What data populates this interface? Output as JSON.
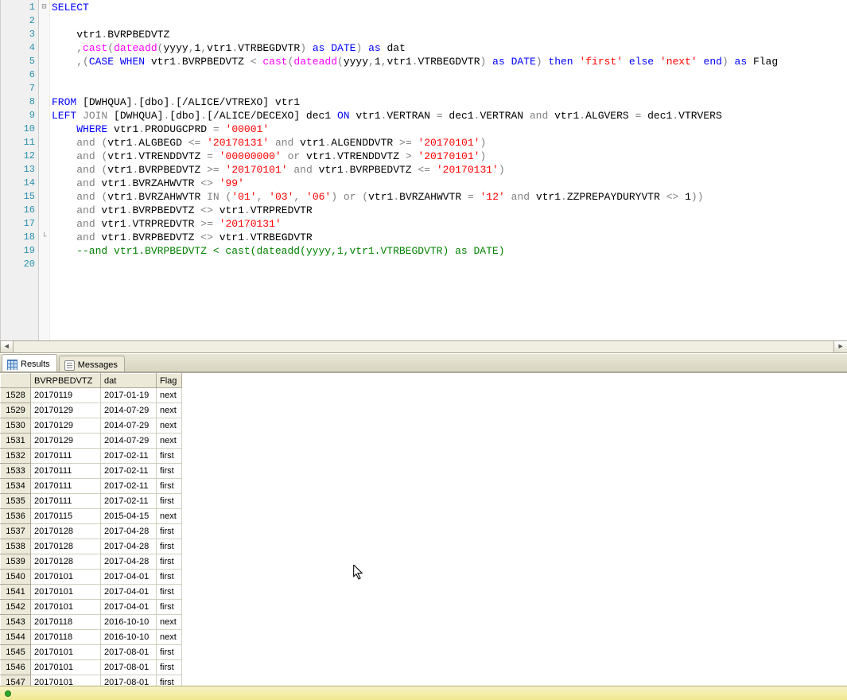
{
  "editor": {
    "lines": [
      {
        "n": 1,
        "fold": "⊟",
        "tokens": [
          {
            "t": "SELECT",
            "c": "kw"
          }
        ]
      },
      {
        "n": 2,
        "fold": "",
        "tokens": []
      },
      {
        "n": 3,
        "fold": "",
        "tokens": [
          {
            "t": "    vtr1"
          },
          {
            "t": ".",
            "c": "op"
          },
          {
            "t": "BVRPBEDVTZ"
          }
        ]
      },
      {
        "n": 4,
        "fold": "",
        "tokens": [
          {
            "t": "    "
          },
          {
            "t": ",",
            "c": "op"
          },
          {
            "t": "cast",
            "c": "fn"
          },
          {
            "t": "(",
            "c": "op"
          },
          {
            "t": "dateadd",
            "c": "fn"
          },
          {
            "t": "(",
            "c": "op"
          },
          {
            "t": "yyyy"
          },
          {
            "t": ",",
            "c": "op"
          },
          {
            "t": "1"
          },
          {
            "t": ",",
            "c": "op"
          },
          {
            "t": "vtr1"
          },
          {
            "t": ".",
            "c": "op"
          },
          {
            "t": "VTRBEGDVTR"
          },
          {
            "t": ")",
            "c": "op"
          },
          {
            "t": " "
          },
          {
            "t": "as",
            "c": "kw"
          },
          {
            "t": " "
          },
          {
            "t": "DATE",
            "c": "kw"
          },
          {
            "t": ")",
            "c": "op"
          },
          {
            "t": " "
          },
          {
            "t": "as",
            "c": "kw"
          },
          {
            "t": " dat"
          }
        ]
      },
      {
        "n": 5,
        "fold": "",
        "tokens": [
          {
            "t": "    "
          },
          {
            "t": ",(",
            "c": "op"
          },
          {
            "t": "CASE",
            "c": "kw"
          },
          {
            "t": " "
          },
          {
            "t": "WHEN",
            "c": "kw"
          },
          {
            "t": " vtr1"
          },
          {
            "t": ".",
            "c": "op"
          },
          {
            "t": "BVRPBEDVTZ "
          },
          {
            "t": "<",
            "c": "op"
          },
          {
            "t": " "
          },
          {
            "t": "cast",
            "c": "fn"
          },
          {
            "t": "(",
            "c": "op"
          },
          {
            "t": "dateadd",
            "c": "fn"
          },
          {
            "t": "(",
            "c": "op"
          },
          {
            "t": "yyyy"
          },
          {
            "t": ",",
            "c": "op"
          },
          {
            "t": "1"
          },
          {
            "t": ",",
            "c": "op"
          },
          {
            "t": "vtr1"
          },
          {
            "t": ".",
            "c": "op"
          },
          {
            "t": "VTRBEGDVTR"
          },
          {
            "t": ")",
            "c": "op"
          },
          {
            "t": " "
          },
          {
            "t": "as",
            "c": "kw"
          },
          {
            "t": " "
          },
          {
            "t": "DATE",
            "c": "kw"
          },
          {
            "t": ")",
            "c": "op"
          },
          {
            "t": " "
          },
          {
            "t": "then",
            "c": "kw"
          },
          {
            "t": " "
          },
          {
            "t": "'first'",
            "c": "str"
          },
          {
            "t": " "
          },
          {
            "t": "else",
            "c": "kw"
          },
          {
            "t": " "
          },
          {
            "t": "'next'",
            "c": "str"
          },
          {
            "t": " "
          },
          {
            "t": "end",
            "c": "kw"
          },
          {
            "t": ")",
            "c": "op"
          },
          {
            "t": " "
          },
          {
            "t": "as",
            "c": "kw"
          },
          {
            "t": " Flag"
          }
        ]
      },
      {
        "n": 6,
        "fold": "",
        "tokens": []
      },
      {
        "n": 7,
        "fold": "",
        "tokens": []
      },
      {
        "n": 8,
        "fold": "",
        "tokens": [
          {
            "t": "FROM",
            "c": "kw"
          },
          {
            "t": " [DWHQUA]"
          },
          {
            "t": ".",
            "c": "op"
          },
          {
            "t": "[dbo]"
          },
          {
            "t": ".",
            "c": "op"
          },
          {
            "t": "[/ALICE/VTREXO] vtr1"
          }
        ]
      },
      {
        "n": 9,
        "fold": "",
        "tokens": [
          {
            "t": "LEFT",
            "c": "kw"
          },
          {
            "t": " "
          },
          {
            "t": "JOIN",
            "c": "op"
          },
          {
            "t": " [DWHQUA]"
          },
          {
            "t": ".",
            "c": "op"
          },
          {
            "t": "[dbo]"
          },
          {
            "t": ".",
            "c": "op"
          },
          {
            "t": "[/ALICE/DECEXO] dec1 "
          },
          {
            "t": "ON",
            "c": "kw"
          },
          {
            "t": " vtr1"
          },
          {
            "t": ".",
            "c": "op"
          },
          {
            "t": "VERTRAN "
          },
          {
            "t": "=",
            "c": "op"
          },
          {
            "t": " dec1"
          },
          {
            "t": ".",
            "c": "op"
          },
          {
            "t": "VERTRAN "
          },
          {
            "t": "and",
            "c": "op"
          },
          {
            "t": " vtr1"
          },
          {
            "t": ".",
            "c": "op"
          },
          {
            "t": "ALGVERS "
          },
          {
            "t": "=",
            "c": "op"
          },
          {
            "t": " dec1"
          },
          {
            "t": ".",
            "c": "op"
          },
          {
            "t": "VTRVERS"
          }
        ]
      },
      {
        "n": 10,
        "fold": "",
        "tokens": [
          {
            "t": "    "
          },
          {
            "t": "WHERE",
            "c": "kw"
          },
          {
            "t": " vtr1"
          },
          {
            "t": ".",
            "c": "op"
          },
          {
            "t": "PRODUGCPRD "
          },
          {
            "t": "=",
            "c": "op"
          },
          {
            "t": " "
          },
          {
            "t": "'00001'",
            "c": "str"
          }
        ]
      },
      {
        "n": 11,
        "fold": "",
        "tokens": [
          {
            "t": "    "
          },
          {
            "t": "and",
            "c": "op"
          },
          {
            "t": " "
          },
          {
            "t": "(",
            "c": "op"
          },
          {
            "t": "vtr1"
          },
          {
            "t": ".",
            "c": "op"
          },
          {
            "t": "ALGBEGD "
          },
          {
            "t": "<=",
            "c": "op"
          },
          {
            "t": " "
          },
          {
            "t": "'20170131'",
            "c": "str"
          },
          {
            "t": " "
          },
          {
            "t": "and",
            "c": "op"
          },
          {
            "t": " vtr1"
          },
          {
            "t": ".",
            "c": "op"
          },
          {
            "t": "ALGENDDVTR "
          },
          {
            "t": ">=",
            "c": "op"
          },
          {
            "t": " "
          },
          {
            "t": "'20170101'",
            "c": "str"
          },
          {
            "t": ")",
            "c": "op"
          }
        ]
      },
      {
        "n": 12,
        "fold": "",
        "tokens": [
          {
            "t": "    "
          },
          {
            "t": "and",
            "c": "op"
          },
          {
            "t": " "
          },
          {
            "t": "(",
            "c": "op"
          },
          {
            "t": "vtr1"
          },
          {
            "t": ".",
            "c": "op"
          },
          {
            "t": "VTRENDDVTZ "
          },
          {
            "t": "=",
            "c": "op"
          },
          {
            "t": " "
          },
          {
            "t": "'00000000'",
            "c": "str"
          },
          {
            "t": " "
          },
          {
            "t": "or",
            "c": "op"
          },
          {
            "t": " vtr1"
          },
          {
            "t": ".",
            "c": "op"
          },
          {
            "t": "VTRENDDVTZ "
          },
          {
            "t": ">",
            "c": "op"
          },
          {
            "t": " "
          },
          {
            "t": "'20170101'",
            "c": "str"
          },
          {
            "t": ")",
            "c": "op"
          }
        ]
      },
      {
        "n": 13,
        "fold": "",
        "tokens": [
          {
            "t": "    "
          },
          {
            "t": "and",
            "c": "op"
          },
          {
            "t": " "
          },
          {
            "t": "(",
            "c": "op"
          },
          {
            "t": "vtr1"
          },
          {
            "t": ".",
            "c": "op"
          },
          {
            "t": "BVRPBEDVTZ "
          },
          {
            "t": ">=",
            "c": "op"
          },
          {
            "t": " "
          },
          {
            "t": "'20170101'",
            "c": "str"
          },
          {
            "t": " "
          },
          {
            "t": "and",
            "c": "op"
          },
          {
            "t": " vtr1"
          },
          {
            "t": ".",
            "c": "op"
          },
          {
            "t": "BVRPBEDVTZ "
          },
          {
            "t": "<=",
            "c": "op"
          },
          {
            "t": " "
          },
          {
            "t": "'20170131'",
            "c": "str"
          },
          {
            "t": ")",
            "c": "op"
          }
        ]
      },
      {
        "n": 14,
        "fold": "",
        "tokens": [
          {
            "t": "    "
          },
          {
            "t": "and",
            "c": "op"
          },
          {
            "t": " vtr1"
          },
          {
            "t": ".",
            "c": "op"
          },
          {
            "t": "BVRZAHWVTR "
          },
          {
            "t": "<>",
            "c": "op"
          },
          {
            "t": " "
          },
          {
            "t": "'99'",
            "c": "str"
          }
        ]
      },
      {
        "n": 15,
        "fold": "",
        "tokens": [
          {
            "t": "    "
          },
          {
            "t": "and",
            "c": "op"
          },
          {
            "t": " "
          },
          {
            "t": "(",
            "c": "op"
          },
          {
            "t": "vtr1"
          },
          {
            "t": ".",
            "c": "op"
          },
          {
            "t": "BVRZAHWVTR "
          },
          {
            "t": "IN",
            "c": "op"
          },
          {
            "t": " "
          },
          {
            "t": "(",
            "c": "op"
          },
          {
            "t": "'01'",
            "c": "str"
          },
          {
            "t": ",",
            "c": "op"
          },
          {
            "t": " "
          },
          {
            "t": "'03'",
            "c": "str"
          },
          {
            "t": ",",
            "c": "op"
          },
          {
            "t": " "
          },
          {
            "t": "'06'",
            "c": "str"
          },
          {
            "t": ")",
            "c": "op"
          },
          {
            "t": " "
          },
          {
            "t": "or",
            "c": "op"
          },
          {
            "t": " "
          },
          {
            "t": "(",
            "c": "op"
          },
          {
            "t": "vtr1"
          },
          {
            "t": ".",
            "c": "op"
          },
          {
            "t": "BVRZAHWVTR "
          },
          {
            "t": "=",
            "c": "op"
          },
          {
            "t": " "
          },
          {
            "t": "'12'",
            "c": "str"
          },
          {
            "t": " "
          },
          {
            "t": "and",
            "c": "op"
          },
          {
            "t": " vtr1"
          },
          {
            "t": ".",
            "c": "op"
          },
          {
            "t": "ZZPREPAYDURYVTR "
          },
          {
            "t": "<>",
            "c": "op"
          },
          {
            "t": " 1"
          },
          {
            "t": "))",
            "c": "op"
          }
        ]
      },
      {
        "n": 16,
        "fold": "",
        "tokens": [
          {
            "t": "    "
          },
          {
            "t": "and",
            "c": "op"
          },
          {
            "t": " vtr1"
          },
          {
            "t": ".",
            "c": "op"
          },
          {
            "t": "BVRPBEDVTZ "
          },
          {
            "t": "<>",
            "c": "op"
          },
          {
            "t": " vtr1"
          },
          {
            "t": ".",
            "c": "op"
          },
          {
            "t": "VTRPREDVTR"
          }
        ]
      },
      {
        "n": 17,
        "fold": "",
        "tokens": [
          {
            "t": "    "
          },
          {
            "t": "and",
            "c": "op"
          },
          {
            "t": " vtr1"
          },
          {
            "t": ".",
            "c": "op"
          },
          {
            "t": "VTRPREDVTR "
          },
          {
            "t": ">=",
            "c": "op"
          },
          {
            "t": " "
          },
          {
            "t": "'20170131'",
            "c": "str"
          }
        ]
      },
      {
        "n": 18,
        "fold": "└",
        "tokens": [
          {
            "t": "    "
          },
          {
            "t": "and",
            "c": "op"
          },
          {
            "t": " vtr1"
          },
          {
            "t": ".",
            "c": "op"
          },
          {
            "t": "BVRPBEDVTZ "
          },
          {
            "t": "<>",
            "c": "op"
          },
          {
            "t": " vtr1"
          },
          {
            "t": ".",
            "c": "op"
          },
          {
            "t": "VTRBEGDVTR"
          }
        ]
      },
      {
        "n": 19,
        "fold": "",
        "tokens": [
          {
            "t": "    --and vtr1.BVRPBEDVTZ < cast(dateadd(yyyy,1,vtr1.VTRBEGDVTR) as DATE)",
            "c": "cmt"
          }
        ]
      },
      {
        "n": 20,
        "fold": "",
        "tokens": []
      }
    ]
  },
  "tabs": {
    "results": "Results",
    "messages": "Messages"
  },
  "grid": {
    "columns": [
      "",
      "BVRPBEDVTZ",
      "dat",
      "Flag"
    ],
    "rows": [
      {
        "n": "1528",
        "c": [
          "20170119",
          "2017-01-19",
          "next"
        ]
      },
      {
        "n": "1529",
        "c": [
          "20170129",
          "2014-07-29",
          "next"
        ]
      },
      {
        "n": "1530",
        "c": [
          "20170129",
          "2014-07-29",
          "next"
        ]
      },
      {
        "n": "1531",
        "c": [
          "20170129",
          "2014-07-29",
          "next"
        ]
      },
      {
        "n": "1532",
        "c": [
          "20170111",
          "2017-02-11",
          "first"
        ]
      },
      {
        "n": "1533",
        "c": [
          "20170111",
          "2017-02-11",
          "first"
        ]
      },
      {
        "n": "1534",
        "c": [
          "20170111",
          "2017-02-11",
          "first"
        ]
      },
      {
        "n": "1535",
        "c": [
          "20170111",
          "2017-02-11",
          "first"
        ]
      },
      {
        "n": "1536",
        "c": [
          "20170115",
          "2015-04-15",
          "next"
        ]
      },
      {
        "n": "1537",
        "c": [
          "20170128",
          "2017-04-28",
          "first"
        ]
      },
      {
        "n": "1538",
        "c": [
          "20170128",
          "2017-04-28",
          "first"
        ]
      },
      {
        "n": "1539",
        "c": [
          "20170128",
          "2017-04-28",
          "first"
        ]
      },
      {
        "n": "1540",
        "c": [
          "20170101",
          "2017-04-01",
          "first"
        ]
      },
      {
        "n": "1541",
        "c": [
          "20170101",
          "2017-04-01",
          "first"
        ]
      },
      {
        "n": "1542",
        "c": [
          "20170101",
          "2017-04-01",
          "first"
        ]
      },
      {
        "n": "1543",
        "c": [
          "20170118",
          "2016-10-10",
          "next"
        ]
      },
      {
        "n": "1544",
        "c": [
          "20170118",
          "2016-10-10",
          "next"
        ]
      },
      {
        "n": "1545",
        "c": [
          "20170101",
          "2017-08-01",
          "first"
        ]
      },
      {
        "n": "1546",
        "c": [
          "20170101",
          "2017-08-01",
          "first"
        ]
      },
      {
        "n": "1547",
        "c": [
          "20170101",
          "2017-08-01",
          "first"
        ]
      }
    ]
  },
  "status": {
    "left": ""
  }
}
